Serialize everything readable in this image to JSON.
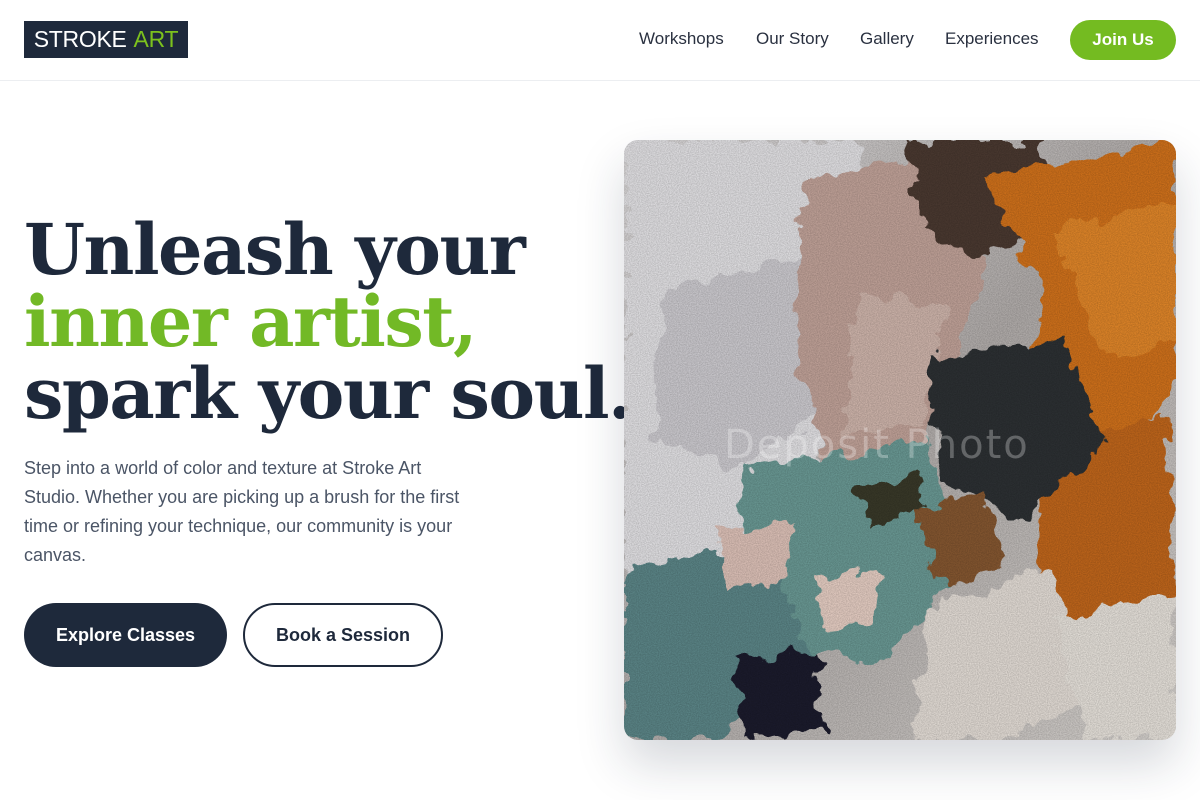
{
  "header": {
    "logo_primary": "STROKE",
    "logo_accent": "ART",
    "nav": [
      {
        "label": "Workshops"
      },
      {
        "label": "Our Story"
      },
      {
        "label": "Gallery"
      },
      {
        "label": "Experiences"
      }
    ],
    "join_label": "Join Us"
  },
  "hero": {
    "headline_line1": "Unleash your",
    "headline_line2": "inner artist,",
    "headline_line3": "spark your soul.",
    "description": "Step into a world of color and texture at Stroke Art Studio. Whether you are picking up a brush for the first time or refining your technique, our community is your canvas.",
    "primary_cta": "Explore Classes",
    "secondary_cta": "Book a Session",
    "image_watermark": "Deposit Photo"
  },
  "colors": {
    "navy": "#1e293b",
    "accent_green": "#74bb21",
    "paint_orange": "#d9761c",
    "paint_teal": "#6e9f9a"
  }
}
